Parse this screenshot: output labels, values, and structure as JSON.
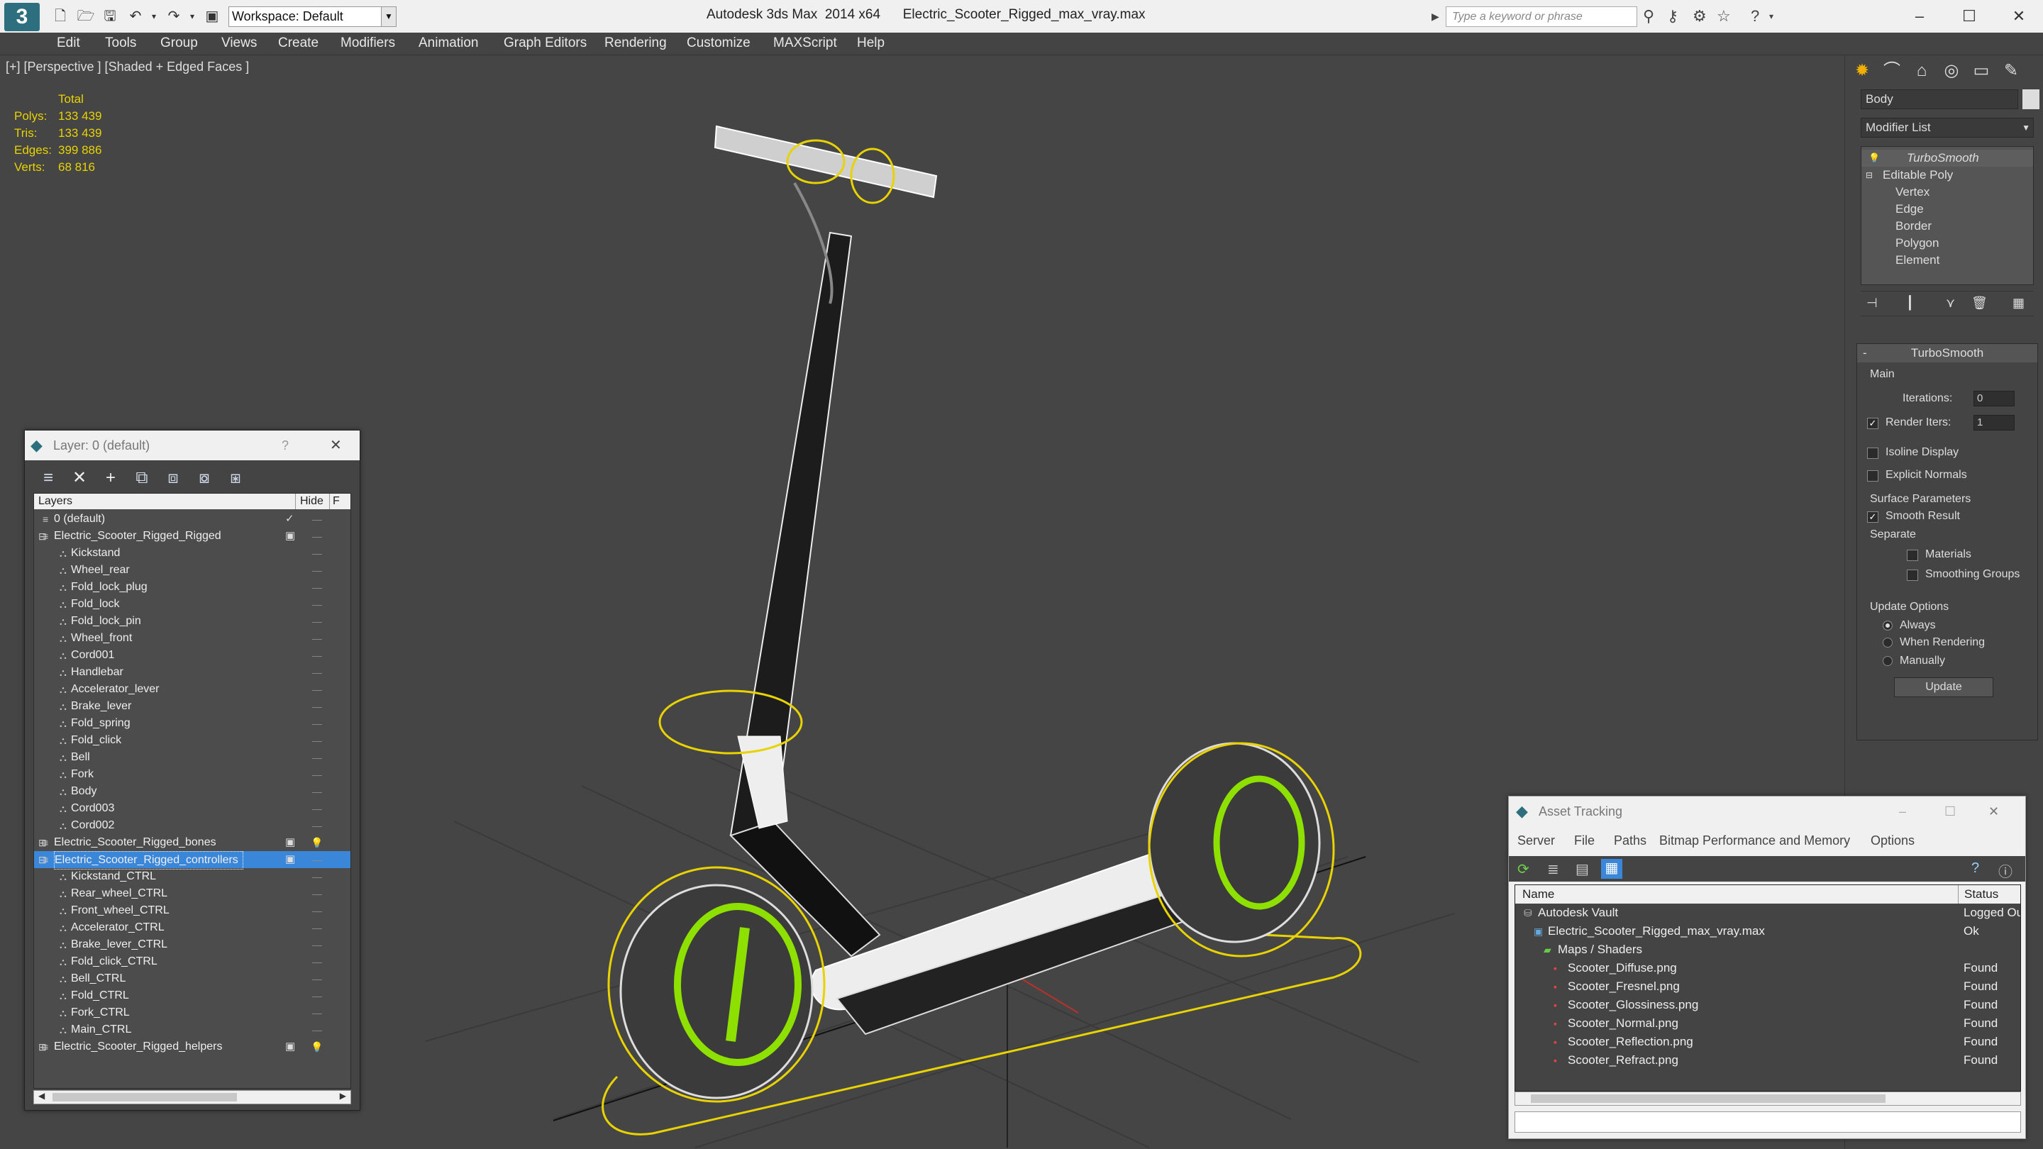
{
  "app": {
    "title": "Autodesk 3ds Max  2014 x64",
    "file": "Electric_Scooter_Rigged_max_vray.max",
    "workspace": "Workspace: Default",
    "search_placeholder": "Type a keyword or phrase"
  },
  "menu": [
    "Edit",
    "Tools",
    "Group",
    "Views",
    "Create",
    "Modifiers",
    "Animation",
    "Graph Editors",
    "Rendering",
    "Customize",
    "MAXScript",
    "Help"
  ],
  "viewport": {
    "label": "[+] [Perspective ] [Shaded + Edged Faces ]",
    "stats": {
      "header": "Total",
      "rows": [
        {
          "k": "Polys:",
          "v": "133 439"
        },
        {
          "k": "Tris:",
          "v": "133 439"
        },
        {
          "k": "Edges:",
          "v": "399 886"
        },
        {
          "k": "Verts:",
          "v": "68 816"
        }
      ]
    }
  },
  "command_panel": {
    "object_name": "Body",
    "modifier_list": "Modifier List",
    "stack": [
      "TurboSmooth",
      "Editable Poly",
      "Vertex",
      "Edge",
      "Border",
      "Polygon",
      "Element"
    ],
    "turbosmooth": {
      "title": "TurboSmooth",
      "main": "Main",
      "iterations_label": "Iterations:",
      "iterations": "0",
      "render_iters_label": "Render Iters:",
      "render_iters": "1",
      "isoline": "Isoline Display",
      "explicit": "Explicit Normals",
      "surface": "Surface Parameters",
      "smooth_result": "Smooth Result",
      "separate": "Separate",
      "materials": "Materials",
      "smoothing_groups": "Smoothing Groups",
      "update_options": "Update Options",
      "always": "Always",
      "when_rendering": "When Rendering",
      "manually": "Manually",
      "update": "Update"
    }
  },
  "layers": {
    "title": "Layer: 0 (default)",
    "help": "?",
    "col_layers": "Layers",
    "col_hide": "Hide",
    "col_f": "F",
    "rows": [
      {
        "name": "0 (default)",
        "level": 1,
        "mark": "check"
      },
      {
        "name": "Electric_Scooter_Rigged_Rigged",
        "level": 1,
        "mark": "box",
        "expanded": true
      },
      {
        "name": "Kickstand",
        "level": 2
      },
      {
        "name": "Wheel_rear",
        "level": 2
      },
      {
        "name": "Fold_lock_plug",
        "level": 2
      },
      {
        "name": "Fold_lock",
        "level": 2
      },
      {
        "name": "Fold_lock_pin",
        "level": 2
      },
      {
        "name": "Wheel_front",
        "level": 2
      },
      {
        "name": "Cord001",
        "level": 2
      },
      {
        "name": "Handlebar",
        "level": 2
      },
      {
        "name": "Accelerator_lever",
        "level": 2
      },
      {
        "name": "Brake_lever",
        "level": 2
      },
      {
        "name": "Fold_spring",
        "level": 2
      },
      {
        "name": "Fold_click",
        "level": 2
      },
      {
        "name": "Bell",
        "level": 2
      },
      {
        "name": "Fork",
        "level": 2
      },
      {
        "name": "Body",
        "level": 2
      },
      {
        "name": "Cord003",
        "level": 2
      },
      {
        "name": "Cord002",
        "level": 2
      },
      {
        "name": "Electric_Scooter_Rigged_bones",
        "level": 1,
        "mark": "box",
        "bulb": true
      },
      {
        "name": "Electric_Scooter_Rigged_controllers",
        "level": 1,
        "mark": "box",
        "selected": true
      },
      {
        "name": "Kickstand_CTRL",
        "level": 2
      },
      {
        "name": "Rear_wheel_CTRL",
        "level": 2
      },
      {
        "name": "Front_wheel_CTRL",
        "level": 2
      },
      {
        "name": "Accelerator_CTRL",
        "level": 2
      },
      {
        "name": "Brake_lever_CTRL",
        "level": 2
      },
      {
        "name": "Fold_click_CTRL",
        "level": 2
      },
      {
        "name": "Bell_CTRL",
        "level": 2
      },
      {
        "name": "Fold_CTRL",
        "level": 2
      },
      {
        "name": "Fork_CTRL",
        "level": 2
      },
      {
        "name": "Main_CTRL",
        "level": 2
      },
      {
        "name": "Electric_Scooter_Rigged_helpers",
        "level": 1,
        "mark": "box",
        "bulb": true
      }
    ]
  },
  "assets": {
    "title": "Asset Tracking",
    "menu": [
      "Server",
      "File",
      "Paths",
      "Bitmap Performance and Memory",
      "Options"
    ],
    "col_name": "Name",
    "col_status": "Status",
    "rows": [
      {
        "name": "Autodesk Vault",
        "status": "Logged Ou",
        "level": 0
      },
      {
        "name": "Electric_Scooter_Rigged_max_vray.max",
        "status": "Ok",
        "level": 1
      },
      {
        "name": "Maps / Shaders",
        "status": "",
        "level": 2
      },
      {
        "name": "Scooter_Diffuse.png",
        "status": "Found",
        "level": 3
      },
      {
        "name": "Scooter_Fresnel.png",
        "status": "Found",
        "level": 3
      },
      {
        "name": "Scooter_Glossiness.png",
        "status": "Found",
        "level": 3
      },
      {
        "name": "Scooter_Normal.png",
        "status": "Found",
        "level": 3
      },
      {
        "name": "Scooter_Reflection.png",
        "status": "Found",
        "level": 3
      },
      {
        "name": "Scooter_Refract.png",
        "status": "Found",
        "level": 3
      }
    ]
  },
  "colors": {
    "selection": "#e8d200",
    "wire": "#ffffff",
    "wheel_accent": "#8ee000",
    "highlight": "#3a86d8"
  }
}
